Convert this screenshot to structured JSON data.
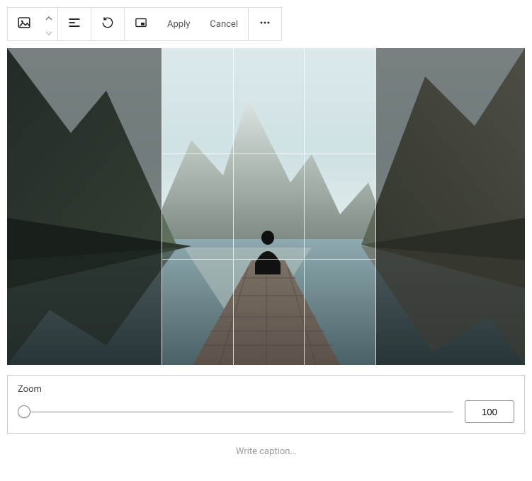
{
  "toolbar": {
    "apply_label": "Apply",
    "cancel_label": "Cancel"
  },
  "zoom": {
    "label": "Zoom",
    "value": "100"
  },
  "caption": {
    "placeholder": "Write caption…"
  }
}
